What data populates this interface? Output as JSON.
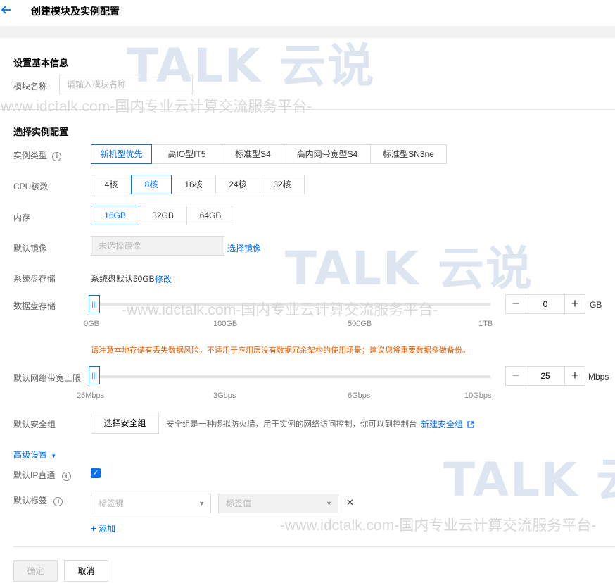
{
  "header": {
    "title": "创建模块及实例配置"
  },
  "basic": {
    "section_title": "设置基本信息",
    "module_name_label": "模块名称",
    "module_name_placeholder": "请输入模块名称"
  },
  "instance": {
    "section_title": "选择实例配置",
    "type_label": "实例类型",
    "types": [
      "新机型优先",
      "高IO型IT5",
      "标准型S4",
      "高内网带宽型S4",
      "标准型SN3ne"
    ],
    "cpu_label": "CPU核数",
    "cpus": [
      "4核",
      "8核",
      "16核",
      "24核",
      "32核"
    ],
    "memory_label": "内存",
    "memories": [
      "16GB",
      "32GB",
      "64GB"
    ],
    "image_label": "默认镜像",
    "image_placeholder": "未选择镜像",
    "image_link": "选择镜像",
    "sysdisk_label": "系统盘存储",
    "sysdisk_value": "系统盘默认50GB",
    "sysdisk_link": "修改",
    "datadisk_label": "数据盘存储",
    "datadisk_ticks": [
      "0GB",
      "100GB",
      "500GB",
      "1TB"
    ],
    "datadisk_value": "0",
    "datadisk_unit": "GB",
    "warning": "请注意本地存储有丢失数据风险，不适用于应用层没有数据冗余架构的使用场景；建议您将重要数据多做备份。",
    "bandwidth_label": "默认网络带宽上限",
    "bandwidth_ticks": [
      "25Mbps",
      "3Gbps",
      "6Gbps",
      "10Gbps"
    ],
    "bandwidth_value": "25",
    "bandwidth_unit": "Mbps",
    "secgroup_label": "默认安全组",
    "secgroup_button": "选择安全组",
    "secgroup_desc": "安全组是一种虚拟防火墙，用于实例的网络访问控制，你可以到控制台",
    "secgroup_link": "新建安全组"
  },
  "advanced": {
    "toggle_label": "高级设置",
    "ip_direct_label": "默认IP直通",
    "tags_label": "默认标签",
    "tag_key_placeholder": "标签键",
    "tag_value_placeholder": "标签值",
    "add_label": "添加"
  },
  "footer": {
    "confirm": "确定",
    "cancel": "取消"
  },
  "watermark": {
    "mark": "TALK 云说",
    "text": "-www.idctalk.com-国内专业云计算交流服务平台-"
  },
  "colors": {
    "accent": "#006eff",
    "warning": "#e65c00"
  }
}
